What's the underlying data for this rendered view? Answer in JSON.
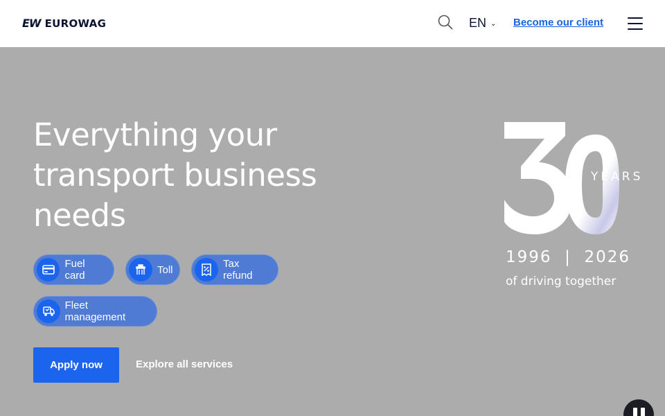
{
  "header": {
    "logo_mark": "EW",
    "logo_text": "EUROWAG",
    "language": "EN",
    "client_link": "Become our client"
  },
  "hero": {
    "title": "Everything your transport business needs",
    "services": [
      {
        "label": "Fuel card",
        "icon": "fuel-card-icon"
      },
      {
        "label": "Toll",
        "icon": "toll-gate-icon"
      },
      {
        "label": "Tax refund",
        "icon": "tax-refund-icon"
      },
      {
        "label": "Fleet management",
        "icon": "fleet-management-icon"
      }
    ],
    "apply_label": "Apply now",
    "explore_label": "Explore all services"
  },
  "anniversary": {
    "number": "30",
    "years_label": "YEARS",
    "dates": "1996  |  2026",
    "tagline": "of driving together"
  },
  "colors": {
    "brand_blue": "#1a64ee",
    "chip_blue": "#4f7bd5",
    "link_blue": "#1a64e0",
    "hero_background": "#acacac",
    "dark_text": "#0a1430"
  }
}
